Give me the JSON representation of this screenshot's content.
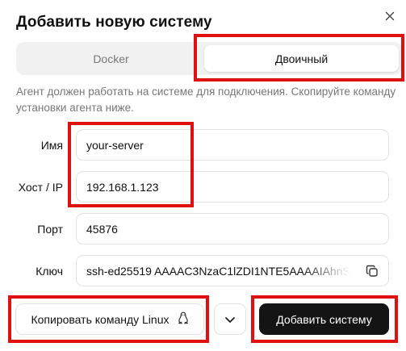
{
  "dialog": {
    "title": "Добавить новую систему",
    "close_icon": "close-icon"
  },
  "tabs": [
    {
      "label": "Docker",
      "active": false
    },
    {
      "label": "Двоичный",
      "active": true
    }
  ],
  "description": "Агент должен работать на системе для подключения. Скопируйте команду установки агента ниже.",
  "fields": {
    "name": {
      "label": "Имя",
      "value": "your-server"
    },
    "host": {
      "label": "Хост / IP",
      "value": "192.168.1.123"
    },
    "port": {
      "label": "Порт",
      "value": "45876"
    },
    "key": {
      "label": "Ключ",
      "value": "ssh-ed25519 AAAAC3NzaC1lZDI1NTE5AAAAIAhnS"
    }
  },
  "actions": {
    "copy_command": "Копировать команду Linux",
    "add_system": "Добавить систему"
  },
  "colors": {
    "primary_button": "#141414",
    "highlight_box": "#e01010",
    "muted_text": "#777777"
  }
}
